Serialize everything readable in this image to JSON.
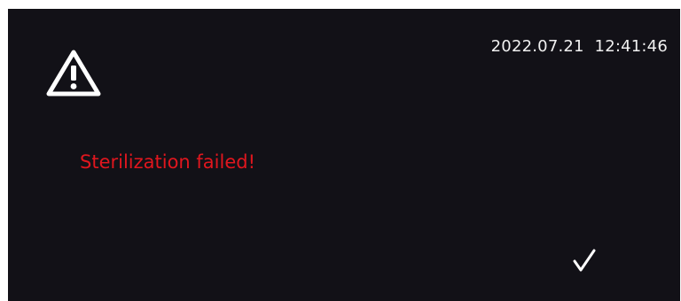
{
  "status": {
    "datetime": "2022.07.21  12:41:46"
  },
  "alert": {
    "icon": "warning-icon",
    "message": "Sterilization failed!",
    "message_color": "#e0161e"
  },
  "actions": {
    "confirm_icon": "checkmark-icon"
  },
  "colors": {
    "background": "#121117",
    "text": "#f0f0f0"
  }
}
